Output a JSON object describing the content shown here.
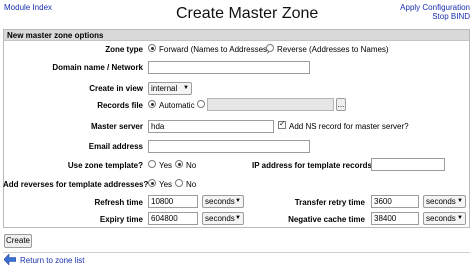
{
  "header": {
    "module_index": "Module Index",
    "title": "Create Master Zone",
    "apply_configuration": "Apply Configuration",
    "stop_bind": "Stop BIND"
  },
  "panel": {
    "heading": "New master zone options"
  },
  "form": {
    "zone_type": {
      "label": "Zone type",
      "forward": "Forward (Names to Addresses)",
      "reverse": "Reverse (Addresses to Names)",
      "selected": "forward"
    },
    "domain": {
      "label": "Domain name / Network",
      "value": ""
    },
    "view": {
      "label": "Create in view",
      "value": "internal"
    },
    "records_file": {
      "label": "Records file",
      "automatic": "Automatic",
      "value": "",
      "browse": "..."
    },
    "master_server": {
      "label": "Master server",
      "value": "hda",
      "add_ns_label": "Add NS record for master server?",
      "add_ns_checked": true
    },
    "email": {
      "label": "Email address",
      "value": ""
    },
    "use_template": {
      "label": "Use zone template?",
      "yes": "Yes",
      "no": "No",
      "selected": "no"
    },
    "template_ip": {
      "label": "IP address for template records",
      "value": ""
    },
    "add_reverses": {
      "label": "Add reverses for template addresses?",
      "yes": "Yes",
      "no": "No",
      "selected": "yes"
    },
    "refresh": {
      "label": "Refresh time",
      "value": "10800",
      "unit": "seconds"
    },
    "transfer_retry": {
      "label": "Transfer retry time",
      "value": "3600",
      "unit": "seconds"
    },
    "expiry": {
      "label": "Expiry time",
      "value": "604800",
      "unit": "seconds"
    },
    "negative_cache": {
      "label": "Negative cache time",
      "value": "38400",
      "unit": "seconds"
    }
  },
  "actions": {
    "create": "Create"
  },
  "footer": {
    "return_link": "Return to zone list"
  },
  "icons": {
    "back_arrow": "back-arrow-icon",
    "select_arrow": "chevron-down-icon"
  },
  "colors": {
    "link": "#1a2fb0",
    "panel_header": "#d9d9d9",
    "back_arrow": "#3b6fd1"
  }
}
